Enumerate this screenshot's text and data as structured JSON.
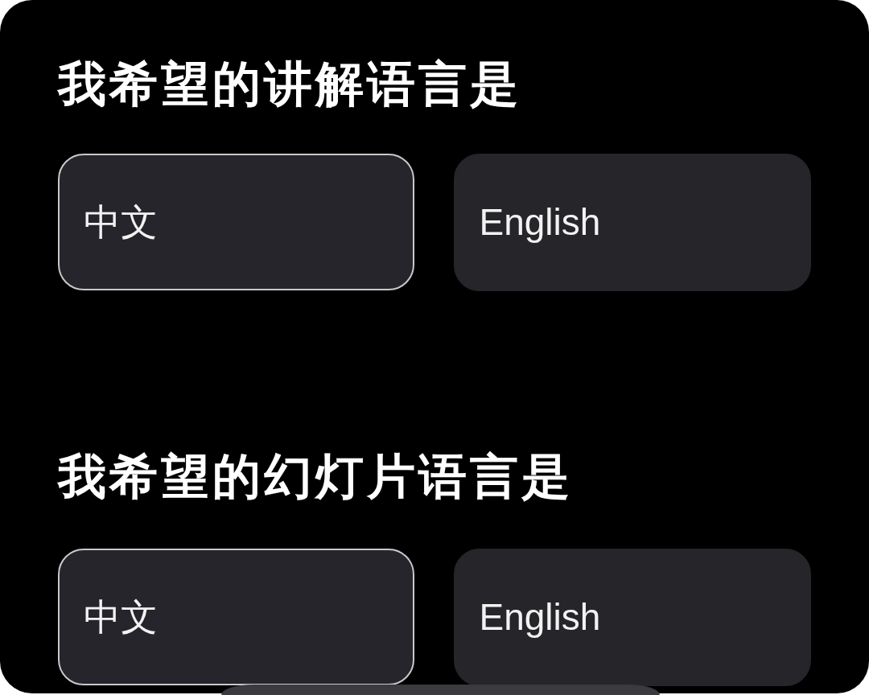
{
  "sections": [
    {
      "title": "我希望的讲解语言是",
      "options": [
        {
          "label": "中文",
          "selected": true
        },
        {
          "label": "English",
          "selected": false
        }
      ]
    },
    {
      "title": "我希望的幻灯片语言是",
      "options": [
        {
          "label": "中文",
          "selected": true
        },
        {
          "label": "English",
          "selected": false
        }
      ]
    }
  ]
}
